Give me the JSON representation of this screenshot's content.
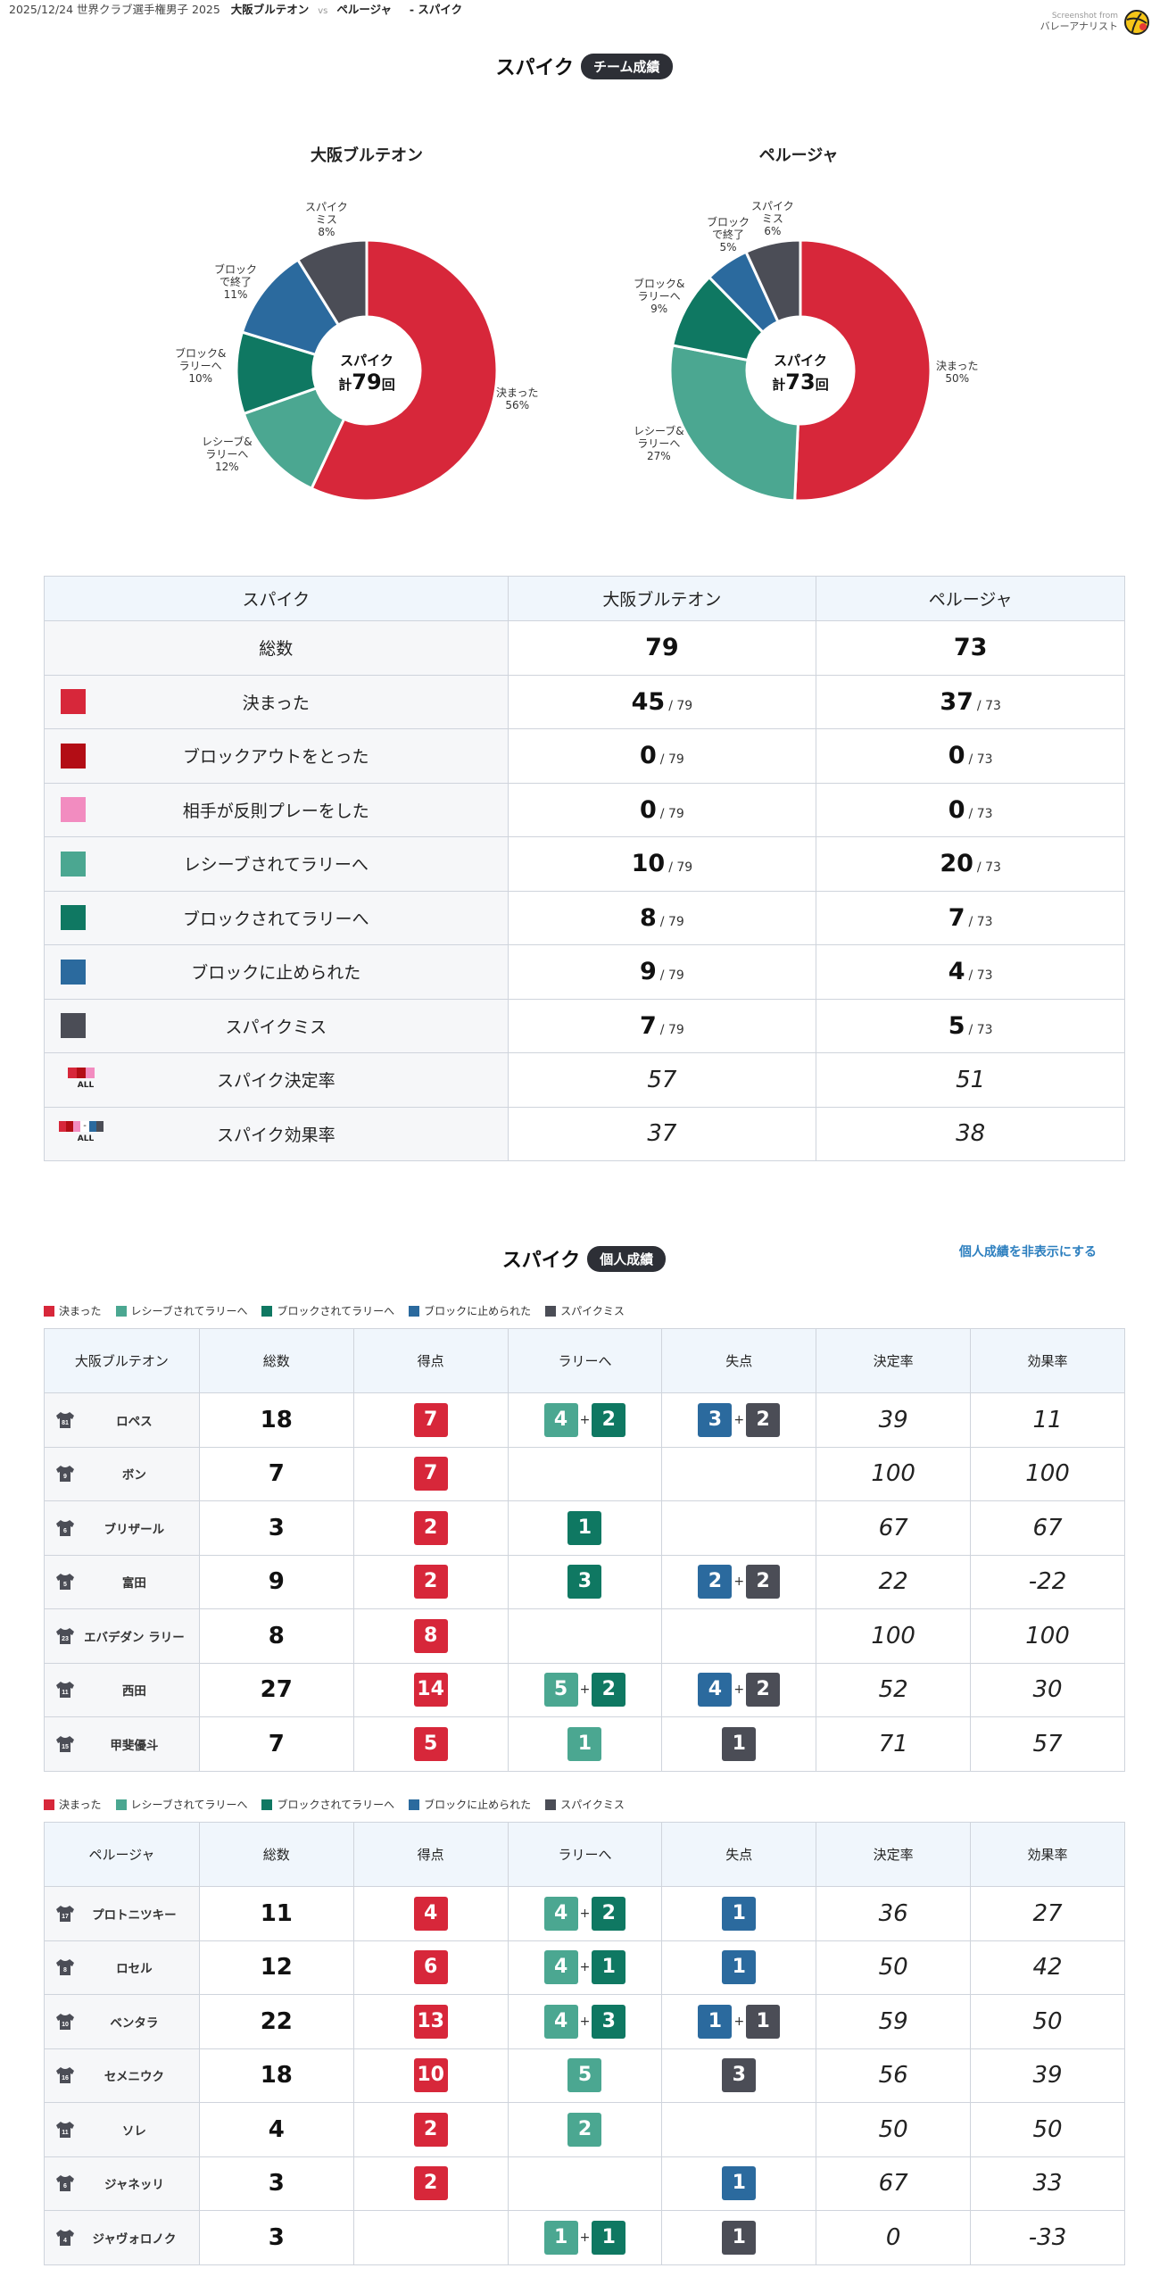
{
  "header": {
    "date_event": "2025/12/24 世界クラブ選手権男子 2025",
    "team_home": "大阪ブルテオン",
    "vs": "vs",
    "team_away": "ペルージャ",
    "section": "- スパイク",
    "brand_small": "Screenshot from",
    "brand_name": "バレーアナリスト"
  },
  "colors": {
    "kimatta": "#d7273a",
    "blockout": "#b30d15",
    "hansoku": "#f28cc0",
    "receive_rally": "#4ba791",
    "block_rally": "#0f7862",
    "blocked": "#2b6a9e",
    "miss": "#4b4d56"
  },
  "team_section": {
    "title": "スパイク",
    "badge": "チーム成績"
  },
  "charts": {
    "home": {
      "name": "大阪ブルテオン",
      "center_title": "スパイク",
      "center_prefix": "計",
      "center_value": "79",
      "center_suffix": "回",
      "labels": {
        "kimatta": "決まった\n56%",
        "receive": "レシーブ&\nラリーへ\n12%",
        "block_rally": "ブロック&\nラリーへ\n10%",
        "blocked": "ブロック\nで終了\n11%",
        "miss": "スパイク\nミス\n8%"
      }
    },
    "away": {
      "name": "ペルージャ",
      "center_title": "スパイク",
      "center_prefix": "計",
      "center_value": "73",
      "center_suffix": "回",
      "labels": {
        "kimatta": "決まった\n50%",
        "receive": "レシーブ&\nラリーへ\n27%",
        "block_rally": "ブロック&\nラリーへ\n9%",
        "blocked": "ブロック\nで終了\n5%",
        "miss": "スパイク\nミス\n6%"
      }
    }
  },
  "chart_data": [
    {
      "type": "pie",
      "title": "大阪ブルテオン",
      "categories": [
        "決まった",
        "レシーブ&ラリーへ",
        "ブロック&ラリーへ",
        "ブロックで終了",
        "スパイクミス"
      ],
      "values": [
        45,
        10,
        8,
        9,
        7
      ],
      "percent": [
        56,
        12,
        10,
        11,
        8
      ],
      "total": 79
    },
    {
      "type": "pie",
      "title": "ペルージャ",
      "categories": [
        "決まった",
        "レシーブ&ラリーへ",
        "ブロック&ラリーへ",
        "ブロックで終了",
        "スパイクミス"
      ],
      "values": [
        37,
        20,
        7,
        4,
        5
      ],
      "percent": [
        50,
        27,
        9,
        5,
        6
      ],
      "total": 73
    }
  ],
  "team_table": {
    "headers": [
      "スパイク",
      "大阪ブルテオン",
      "ペルージャ"
    ],
    "total_row": {
      "label": "総数",
      "home": "79",
      "away": "73"
    },
    "rows": [
      {
        "label": "決まった",
        "home": "45",
        "away": "37",
        "color": "#d7273a"
      },
      {
        "label": "ブロックアウトをとった",
        "home": "0",
        "away": "0",
        "color": "#b30d15"
      },
      {
        "label": "相手が反則プレーをした",
        "home": "0",
        "away": "0",
        "color": "#f28cc0"
      },
      {
        "label": "レシーブされてラリーへ",
        "home": "10",
        "away": "20",
        "color": "#4ba791"
      },
      {
        "label": "ブロックされてラリーへ",
        "home": "8",
        "away": "7",
        "color": "#0f7862"
      },
      {
        "label": "ブロックに止められた",
        "home": "9",
        "away": "4",
        "color": "#2b6a9e"
      },
      {
        "label": "スパイクミス",
        "home": "7",
        "away": "5",
        "color": "#4b4d56"
      }
    ],
    "home_of": "/ 79",
    "away_of": "/ 73",
    "rate_rows": [
      {
        "label": "スパイク決定率",
        "home": "57",
        "away": "51",
        "mark": "ALL"
      },
      {
        "label": "スパイク効果率",
        "home": "37",
        "away": "38",
        "mark": "ALL"
      }
    ]
  },
  "individual_section": {
    "title": "スパイク",
    "badge": "個人成績",
    "hide_link": "個人成績を非表示にする"
  },
  "legend": [
    "決まった",
    "レシーブされてラリーへ",
    "ブロックされてラリーへ",
    "ブロックに止められた",
    "スパイクミス"
  ],
  "ind_headers_rest": [
    "総数",
    "得点",
    "ラリーへ",
    "失点",
    "決定率",
    "効果率"
  ],
  "home_players": {
    "team": "大阪ブルテオン",
    "rows": [
      {
        "no": "81",
        "name": "ロペス",
        "total": "18",
        "pts": "7",
        "rally": [
          "4",
          "2"
        ],
        "lost": [
          "3",
          "2"
        ],
        "rate": "39",
        "eff": "11"
      },
      {
        "no": "9",
        "name": "ボン",
        "total": "7",
        "pts": "7",
        "rally": [
          null,
          null
        ],
        "lost": [
          null,
          null
        ],
        "rate": "100",
        "eff": "100"
      },
      {
        "no": "6",
        "name": "ブリザール",
        "total": "3",
        "pts": "2",
        "rally": [
          null,
          "1"
        ],
        "lost": [
          null,
          null
        ],
        "rate": "67",
        "eff": "67"
      },
      {
        "no": "5",
        "name": "富田",
        "total": "9",
        "pts": "2",
        "rally": [
          null,
          "3"
        ],
        "lost": [
          "2",
          "2"
        ],
        "rate": "22",
        "eff": "-22"
      },
      {
        "no": "23",
        "name": "エバデダン ラリー",
        "total": "8",
        "pts": "8",
        "rally": [
          null,
          null
        ],
        "lost": [
          null,
          null
        ],
        "rate": "100",
        "eff": "100"
      },
      {
        "no": "11",
        "name": "西田",
        "total": "27",
        "pts": "14",
        "rally": [
          "5",
          "2"
        ],
        "lost": [
          "4",
          "2"
        ],
        "rate": "52",
        "eff": "30"
      },
      {
        "no": "15",
        "name": "甲斐優斗",
        "total": "7",
        "pts": "5",
        "rally": [
          "1",
          null
        ],
        "lost": [
          null,
          "1"
        ],
        "rate": "71",
        "eff": "57"
      }
    ]
  },
  "away_players": {
    "team": "ペルージャ",
    "rows": [
      {
        "no": "17",
        "name": "プロトニツキー",
        "total": "11",
        "pts": "4",
        "rally": [
          "4",
          "2"
        ],
        "lost": [
          "1",
          null
        ],
        "rate": "36",
        "eff": "27"
      },
      {
        "no": "8",
        "name": "ロセル",
        "total": "12",
        "pts": "6",
        "rally": [
          "4",
          "1"
        ],
        "lost": [
          "1",
          null
        ],
        "rate": "50",
        "eff": "42"
      },
      {
        "no": "10",
        "name": "ベンタラ",
        "total": "22",
        "pts": "13",
        "rally": [
          "4",
          "3"
        ],
        "lost": [
          "1",
          "1"
        ],
        "rate": "59",
        "eff": "50"
      },
      {
        "no": "16",
        "name": "セメニウク",
        "total": "18",
        "pts": "10",
        "rally": [
          "5",
          null
        ],
        "lost": [
          null,
          "3"
        ],
        "rate": "56",
        "eff": "39"
      },
      {
        "no": "11",
        "name": "ソレ",
        "total": "4",
        "pts": "2",
        "rally": [
          "2",
          null
        ],
        "lost": [
          null,
          null
        ],
        "rate": "50",
        "eff": "50"
      },
      {
        "no": "6",
        "name": "ジャネッリ",
        "total": "3",
        "pts": "2",
        "rally": [
          null,
          null
        ],
        "lost": [
          "1",
          null
        ],
        "rate": "67",
        "eff": "33"
      },
      {
        "no": "4",
        "name": "ジャヴォロノク",
        "total": "3",
        "pts": null,
        "rally": [
          "1",
          "1"
        ],
        "lost": [
          null,
          "1"
        ],
        "rate": "0",
        "eff": "-33"
      }
    ]
  }
}
